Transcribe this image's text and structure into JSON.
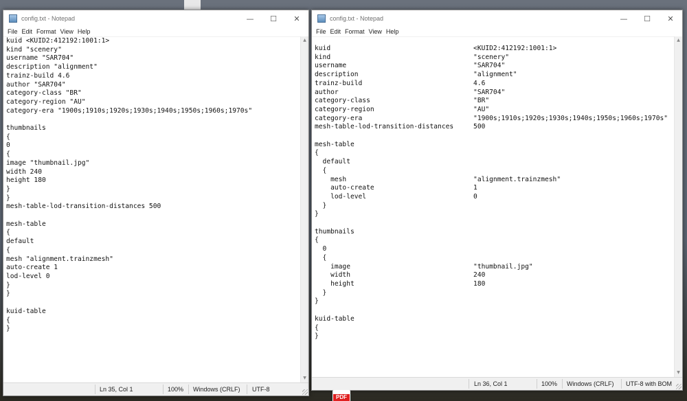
{
  "left": {
    "title": "config.txt - Notepad",
    "menu": [
      "File",
      "Edit",
      "Format",
      "View",
      "Help"
    ],
    "content": "kuid <KUID2:412192:1001:1>\nkind \"scenery\"\nusername \"SAR704\"\ndescription \"alignment\"\ntrainz-build 4.6\nauthor \"SAR704\"\ncategory-class \"BR\"\ncategory-region \"AU\"\ncategory-era \"1900s;1910s;1920s;1930s;1940s;1950s;1960s;1970s\"\n\nthumbnails\n{\n0\n{\nimage \"thumbnail.jpg\"\nwidth 240\nheight 180\n}\n}\nmesh-table-lod-transition-distances 500\n\nmesh-table\n{\ndefault\n{\nmesh \"alignment.trainzmesh\"\nauto-create 1\nlod-level 0\n}\n}\n\nkuid-table\n{\n}",
    "status": {
      "position": "Ln 35, Col 1",
      "zoom": "100%",
      "line_ending": "Windows (CRLF)",
      "encoding": "UTF-8"
    }
  },
  "right": {
    "title": "config.txt - Notepad",
    "menu": [
      "File",
      "Edit",
      "Format",
      "View",
      "Help"
    ],
    "content": "kuid                                    <KUID2:412192:1001:1>\nkind                                    \"scenery\"\nusername                                \"SAR704\"\ndescription                             \"alignment\"\ntrainz-build                            4.6\nauthor                                  \"SAR704\"\ncategory-class                          \"BR\"\ncategory-region                         \"AU\"\ncategory-era                            \"1900s;1910s;1920s;1930s;1940s;1950s;1960s;1970s\"\nmesh-table-lod-transition-distances     500\n\nmesh-table\n{\n  default\n  {\n    mesh                                \"alignment.trainzmesh\"\n    auto-create                         1\n    lod-level                           0\n  }\n}\n\nthumbnails\n{\n  0\n  {\n    image                               \"thumbnail.jpg\"\n    width                               240\n    height                              180\n  }\n}\n\nkuid-table\n{\n}",
    "status": {
      "position": "Ln 36, Col 1",
      "zoom": "100%",
      "line_ending": "Windows (CRLF)",
      "encoding": "UTF-8 with BOM"
    }
  },
  "window_controls": {
    "minimize": "—",
    "maximize": "☐",
    "close": "✕"
  },
  "taskbar_icon": {
    "label": "PDF"
  }
}
